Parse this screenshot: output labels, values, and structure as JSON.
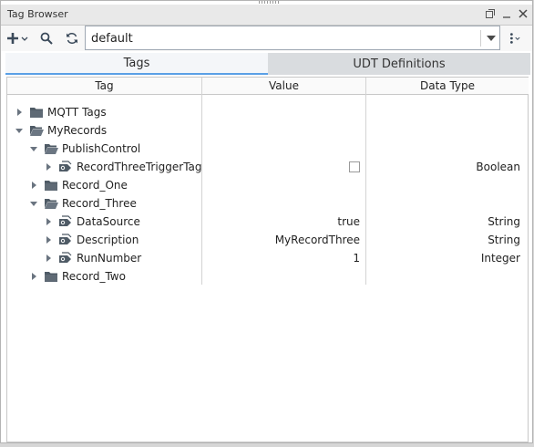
{
  "window": {
    "title": "Tag Browser"
  },
  "toolbar": {
    "provider_value": "default"
  },
  "tabs": [
    {
      "label": "Tags"
    },
    {
      "label": "UDT Definitions"
    }
  ],
  "columns": {
    "tag": "Tag",
    "value": "Value",
    "data_type": "Data Type"
  },
  "rows": [
    {
      "name": "MQTT Tags",
      "type": "folder",
      "state": "collapsed",
      "value": "",
      "data_type": ""
    },
    {
      "name": "MyRecords",
      "type": "folder",
      "state": "expanded",
      "value": "",
      "data_type": ""
    },
    {
      "name": "PublishControl",
      "type": "folder",
      "state": "expanded",
      "value": "",
      "data_type": ""
    },
    {
      "name": "RecordThreeTriggerTag",
      "type": "tag",
      "state": "collapsed",
      "value": "",
      "checkbox_checked": false,
      "data_type": "Boolean"
    },
    {
      "name": "Record_One",
      "type": "folder",
      "state": "collapsed",
      "value": "",
      "data_type": ""
    },
    {
      "name": "Record_Three",
      "type": "folder",
      "state": "expanded",
      "value": "",
      "data_type": ""
    },
    {
      "name": "DataSource",
      "type": "tag",
      "state": "collapsed",
      "value": "true",
      "data_type": "String"
    },
    {
      "name": "Description",
      "type": "tag",
      "state": "collapsed",
      "value": "MyRecordThree",
      "data_type": "String"
    },
    {
      "name": "RunNumber",
      "type": "tag",
      "state": "collapsed",
      "value": "1",
      "data_type": "Integer"
    },
    {
      "name": "Record_Two",
      "type": "folder",
      "state": "collapsed",
      "value": "",
      "data_type": ""
    }
  ],
  "colors": {
    "accent": "#5aa0e6",
    "folder": "#4f5b66",
    "tab_inactive": "#d9dcdf"
  }
}
